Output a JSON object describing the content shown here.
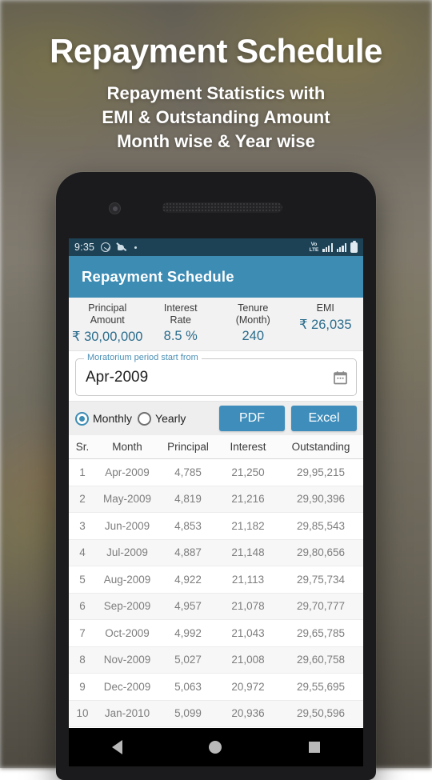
{
  "promo": {
    "title": "Repayment Schedule",
    "subtitle_lines": [
      "Repayment Statistics with",
      "EMI & Outstanding Amount",
      "Month wise & Year wise"
    ]
  },
  "colors": {
    "appbar": "#3d8cb4",
    "button": "#3e8dbb",
    "accent_value": "#2b6c8c",
    "statusbar": "#1d4256",
    "field_label": "#4a8fb5"
  },
  "status_bar": {
    "time": "9:35",
    "volte": "VoLTE",
    "icons": [
      "alarm-circle-icon",
      "mute-icon",
      "dot-icon",
      "volte-badge",
      "signal-bars-1",
      "signal-bars-2",
      "battery-icon"
    ]
  },
  "app": {
    "title": "Repayment Schedule"
  },
  "summary": [
    {
      "label": "Principal\nAmount",
      "label_line1": "Principal",
      "label_line2": "Amount",
      "value": "₹ 30,00,000"
    },
    {
      "label": "Interest Rate",
      "label_line1": "Interest",
      "label_line2": "Rate",
      "value": "8.5 %"
    },
    {
      "label": "Tenure (Month)",
      "label_line1": "Tenure",
      "label_line2": "(Month)",
      "value": "240"
    },
    {
      "label": "EMI",
      "label_line1": "EMI",
      "label_line2": "",
      "value": "₹ 26,035"
    }
  ],
  "date_field": {
    "label": "Moratorium period start from",
    "value": "Apr-2009",
    "icon": "calendar-icon"
  },
  "controls": {
    "radios": [
      {
        "label": "Monthly",
        "selected": true
      },
      {
        "label": "Yearly",
        "selected": false
      }
    ],
    "pdf_label": "PDF",
    "excel_label": "Excel"
  },
  "table": {
    "headers": [
      "Sr.",
      "Month",
      "Principal",
      "Interest",
      "Outstanding"
    ],
    "rows": [
      [
        "1",
        "Apr-2009",
        "4,785",
        "21,250",
        "29,95,215"
      ],
      [
        "2",
        "May-2009",
        "4,819",
        "21,216",
        "29,90,396"
      ],
      [
        "3",
        "Jun-2009",
        "4,853",
        "21,182",
        "29,85,543"
      ],
      [
        "4",
        "Jul-2009",
        "4,887",
        "21,148",
        "29,80,656"
      ],
      [
        "5",
        "Aug-2009",
        "4,922",
        "21,113",
        "29,75,734"
      ],
      [
        "6",
        "Sep-2009",
        "4,957",
        "21,078",
        "29,70,777"
      ],
      [
        "7",
        "Oct-2009",
        "4,992",
        "21,043",
        "29,65,785"
      ],
      [
        "8",
        "Nov-2009",
        "5,027",
        "21,008",
        "29,60,758"
      ],
      [
        "9",
        "Dec-2009",
        "5,063",
        "20,972",
        "29,55,695"
      ],
      [
        "10",
        "Jan-2010",
        "5,099",
        "20,936",
        "29,50,596"
      ]
    ]
  },
  "nav_bar": {
    "items": [
      "back-button",
      "home-button",
      "recents-button"
    ]
  }
}
